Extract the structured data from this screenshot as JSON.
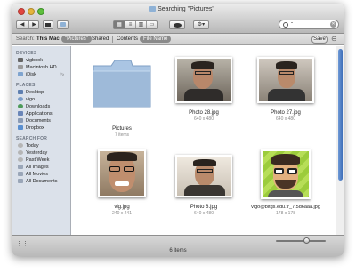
{
  "window": {
    "title": "Searching \"Pictures\""
  },
  "toolbar": {
    "back": "◀",
    "forward": "▶",
    "action_label": "⚙▾",
    "eye": "👁"
  },
  "search": {
    "value": "\"",
    "placeholder": ""
  },
  "scope": {
    "search_label": "Search:",
    "this_mac": "This Mac",
    "pictures_pill": "\"Pictures\"",
    "shared": "Shared",
    "contents": "Contents",
    "file_name": "File Name",
    "save": "Save"
  },
  "sidebar": {
    "devices_header": "DEVICES",
    "devices": [
      "vigbook",
      "Macintosh HD",
      "iDisk"
    ],
    "places_header": "PLACES",
    "places": [
      "Desktop",
      "vigo",
      "Downloads",
      "Applications",
      "Documents",
      "Dropbox"
    ],
    "search_header": "SEARCH FOR",
    "searches": [
      "Today",
      "Yesterday",
      "Past Week",
      "All Images",
      "All Movies",
      "All Documents"
    ]
  },
  "items": [
    {
      "name": "Pictures",
      "meta": "7 items"
    },
    {
      "name": "Photo 28.jpg",
      "meta": "640 x 480"
    },
    {
      "name": "Photo 27.jpg",
      "meta": "640 x 480"
    },
    {
      "name": "vig.jpg",
      "meta": "240 x 241"
    },
    {
      "name": "Photo 8.jpg",
      "meta": "640 x 480"
    },
    {
      "name": "vigo@bitgs.edu.tr_7.5d6aaa.jpg",
      "meta": "178 x 178"
    }
  ],
  "status": {
    "count": "6 items"
  },
  "colors": {
    "accent": "#3c6db8",
    "sidebar_bg": "#dbe1ea",
    "folder": "#8fb2d6"
  }
}
